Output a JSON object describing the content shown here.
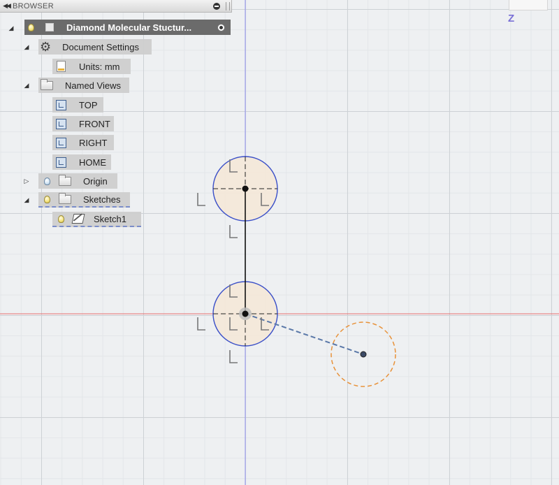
{
  "browser": {
    "title": "BROWSER",
    "root": {
      "label": "Diamond Molecular Stuctur..."
    },
    "document_settings": {
      "label": "Document Settings",
      "units_label": "Units: mm"
    },
    "named_views": {
      "label": "Named Views",
      "items": [
        "TOP",
        "FRONT",
        "RIGHT",
        "HOME"
      ]
    },
    "origin": {
      "label": "Origin"
    },
    "sketches": {
      "label": "Sketches",
      "items": [
        "Sketch1"
      ]
    }
  },
  "viewcube": {
    "axis_label": "Z"
  },
  "colors": {
    "x_axis": "#e87070",
    "y_axis": "#8e8ef0",
    "circle": "#3a4fc8",
    "circle_fill": "#f4e8d8",
    "construction_circle": "#e8923a",
    "construction_line": "#5a78a8"
  }
}
